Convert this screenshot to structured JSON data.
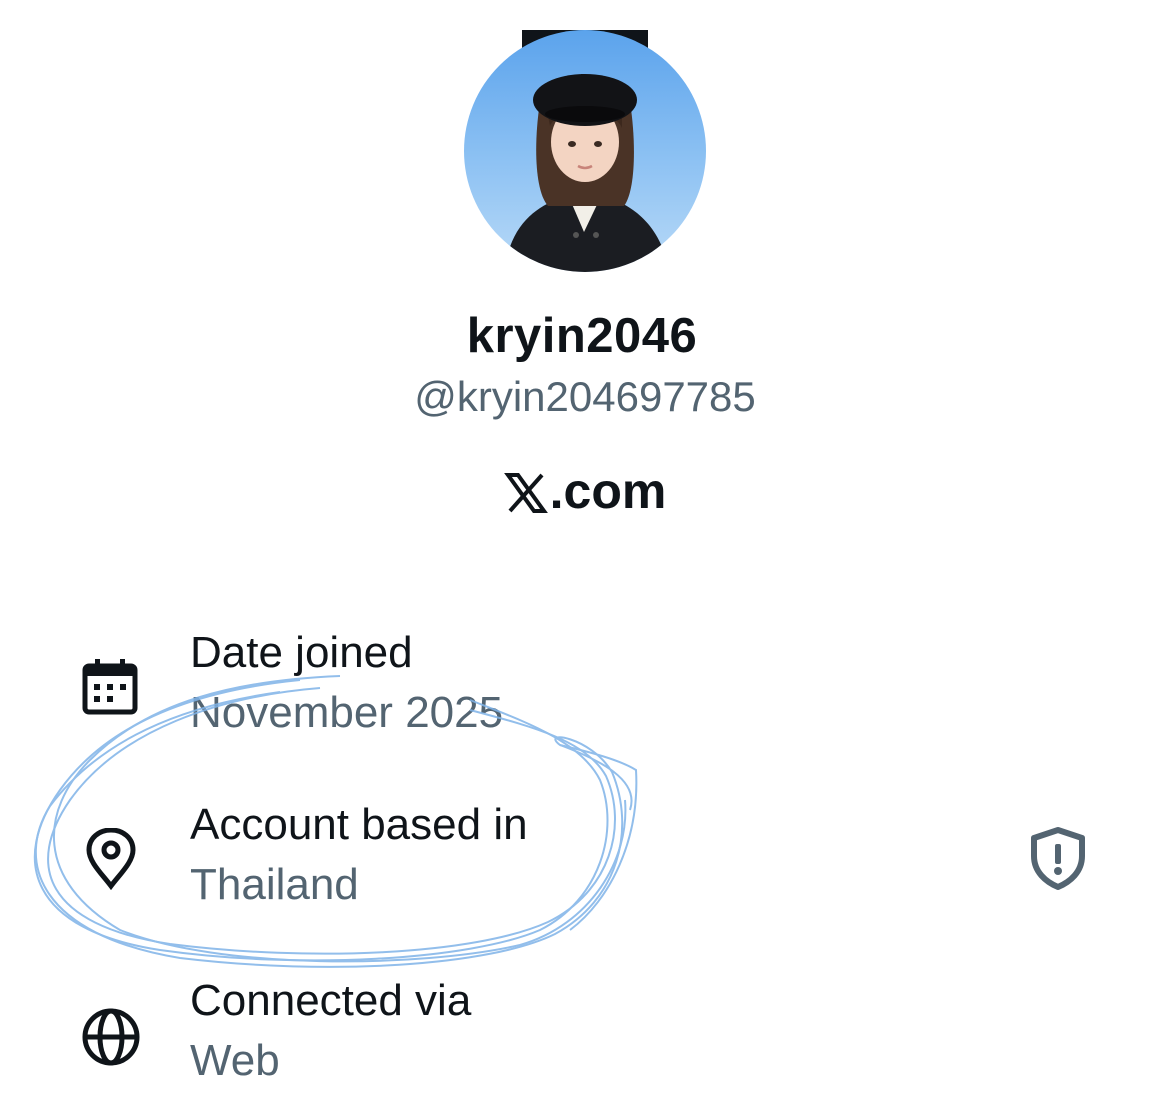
{
  "profile": {
    "display_name": "kryin2046",
    "handle": "@kryin204697785",
    "site": ".com",
    "site_logo_icon": "x-logo-icon"
  },
  "about": {
    "date_joined": {
      "label": "Date joined",
      "value": "November 2025",
      "icon": "calendar-icon"
    },
    "account_based_in": {
      "label": "Account based in",
      "value": "Thailand",
      "icon": "location-pin-icon",
      "badge_icon": "shield-alert-icon"
    },
    "connected_via": {
      "label": "Connected via",
      "value": "Web",
      "icon": "globe-icon"
    }
  },
  "colors": {
    "primary_text": "#0f1419",
    "secondary_text": "#536471",
    "annotation": "#7fb3e8"
  }
}
